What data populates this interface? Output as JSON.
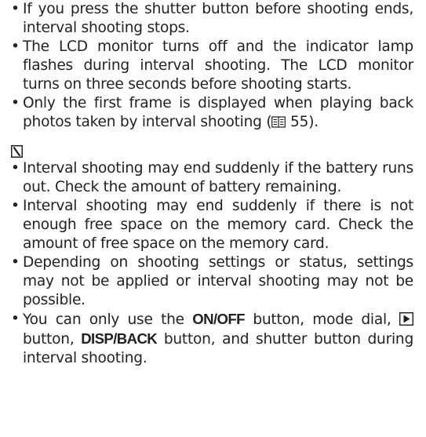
{
  "notes": [
    "If you press the shutter button before shooting ends, interval shooting stops.",
    "The LCD monitor turns off and the indicator lamp flashes during interval shooting. The LCD monitor turns on three seconds before shooting starts.",
    {
      "before": "Only the first frame is displayed when playing back photos taken by interval shooting (",
      "page_ref": "55",
      "after": ")."
    }
  ],
  "caution_icon": "caution-icon",
  "cautions": [
    "Interval shooting may end suddenly if the battery runs out. Check the amount of battery remaining.",
    "Interval shooting may end suddenly if there is not enough free space on the memory card. Check the amount of free space on the memory card.",
    "Depending on shooting settings or status, settings may not be applied or interval shooting may not be possible.",
    {
      "t1": "You can only use the ",
      "b1": "ON/OFF",
      "t2": " button, mode dial, ",
      "icon": "playback-button-icon",
      "t3": " button, ",
      "b2": "DISP/BACK",
      "t4": " button, and shutter button during interval shooting."
    }
  ]
}
